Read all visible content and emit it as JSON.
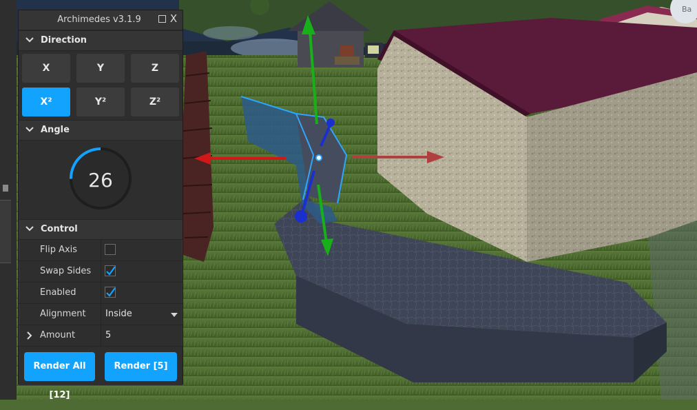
{
  "panel": {
    "title": "Archimedes v3.1.9",
    "close_label": "X"
  },
  "direction": {
    "header": "Direction",
    "buttons": [
      {
        "label": "X",
        "active": false
      },
      {
        "label": "Y",
        "active": false
      },
      {
        "label": "Z",
        "active": false
      },
      {
        "label": "X²",
        "active": true
      },
      {
        "label": "Y²",
        "active": false
      },
      {
        "label": "Z²",
        "active": false
      }
    ]
  },
  "angle": {
    "header": "Angle",
    "value": "26",
    "fraction_of_full": 0.072
  },
  "control": {
    "header": "Control",
    "flip_axis": {
      "label": "Flip Axis",
      "checked": false
    },
    "swap_sides": {
      "label": "Swap Sides",
      "checked": true
    },
    "enabled": {
      "label": "Enabled",
      "checked": true
    },
    "alignment": {
      "label": "Alignment",
      "value": "Inside"
    },
    "amount": {
      "label": "Amount",
      "value": "5"
    }
  },
  "render": {
    "render_all_label": "Render All [12]",
    "render_label": "Render [5]"
  },
  "colors": {
    "accent": "#12a3ff",
    "panel_bg": "#2e2e2e",
    "header_bg": "#353535",
    "axis_x": "#d01818",
    "axis_y": "#18b018",
    "axis_z": "#1a2fd0"
  },
  "scene": {
    "corner_tag": "Ba"
  }
}
